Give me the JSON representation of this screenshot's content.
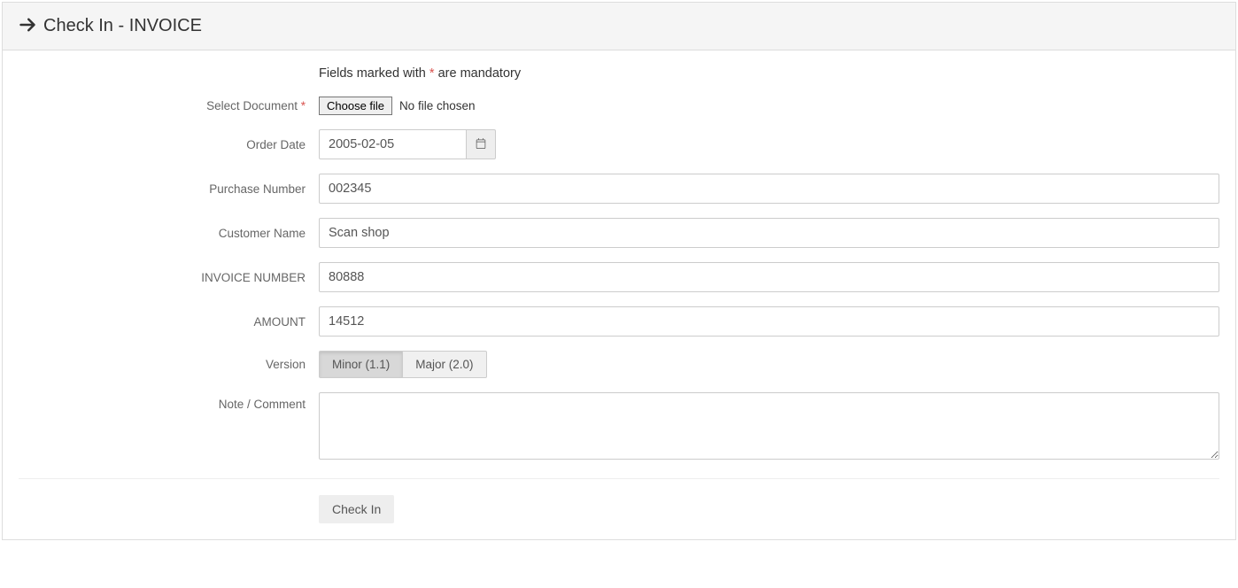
{
  "header": {
    "title": "Check In - INVOICE"
  },
  "mandatory_note": {
    "prefix": "Fields marked with ",
    "star": "*",
    "suffix": " are mandatory"
  },
  "labels": {
    "select_document": "Select Document",
    "order_date": "Order Date",
    "purchase_number": "Purchase Number",
    "customer_name": "Customer Name",
    "invoice_number": "INVOICE NUMBER",
    "amount": "AMOUNT",
    "version": "Version",
    "note_comment": "Note / Comment"
  },
  "file": {
    "button": "Choose file",
    "status": "No file chosen"
  },
  "values": {
    "order_date": "2005-02-05",
    "purchase_number": "002345",
    "customer_name": "Scan shop",
    "invoice_number": "80888",
    "amount": "14512",
    "note": ""
  },
  "version": {
    "minor": "Minor (1.1)",
    "major": "Major (2.0)",
    "selected": "minor"
  },
  "actions": {
    "submit": "Check In"
  }
}
